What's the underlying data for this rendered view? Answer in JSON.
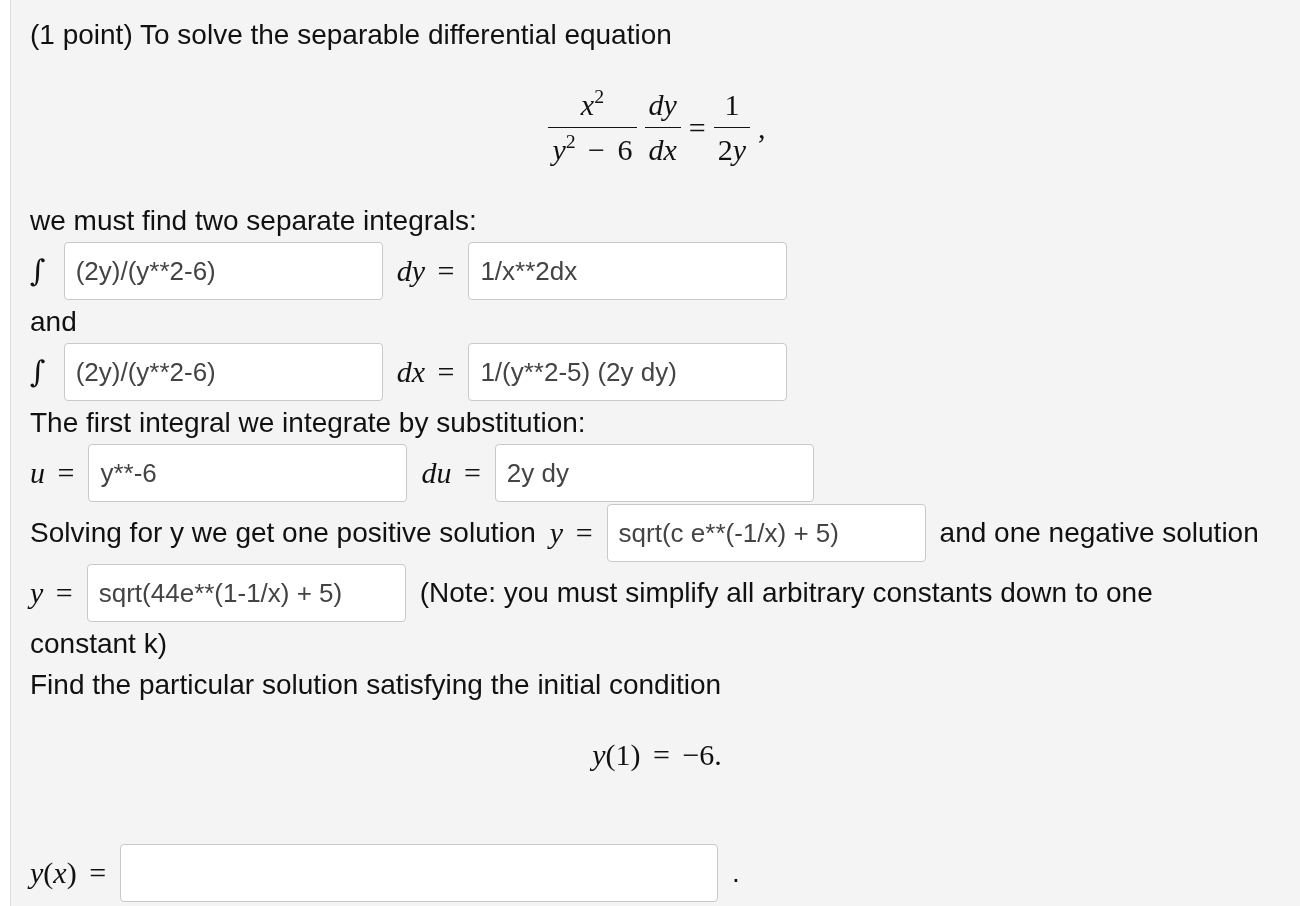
{
  "problem": {
    "blocks": [
      {
        "kind": "line",
        "items": [
          {
            "kind": "text",
            "text": "(1 point) To solve the separable differential equation"
          }
        ]
      },
      {
        "kind": "display",
        "parts": [
          {
            "kind": "fraction",
            "numerator": "x$^{2}$",
            "denominator": "y$^{2}$ − 6"
          },
          {
            "kind": "fraction",
            "numerator": "dy",
            "denominator": "dx"
          },
          {
            "kind": "symbol",
            "text": "="
          },
          {
            "kind": "fraction",
            "numerator": "1",
            "denominator": "2y"
          },
          {
            "kind": "symbol",
            "text": ","
          }
        ]
      },
      {
        "kind": "line",
        "items": [
          {
            "kind": "text",
            "text": "we must find two separate integrals:"
          }
        ]
      },
      {
        "kind": "line",
        "items": [
          {
            "kind": "integral",
            "text": "∫"
          },
          {
            "kind": "input",
            "value": "(2y)/(y**2-6)"
          },
          {
            "kind": "math",
            "text": "dy ="
          },
          {
            "kind": "input",
            "value": "1/x**2dx"
          }
        ]
      },
      {
        "kind": "line",
        "items": [
          {
            "kind": "text",
            "text": "and"
          }
        ]
      },
      {
        "kind": "line",
        "items": [
          {
            "kind": "integral",
            "text": "∫"
          },
          {
            "kind": "input",
            "value": "(2y)/(y**2-6)"
          },
          {
            "kind": "math",
            "text": "dx ="
          },
          {
            "kind": "input",
            "value": "1/(y**2-5) (2y dy)"
          }
        ]
      },
      {
        "kind": "line",
        "items": [
          {
            "kind": "text",
            "text": "The first integral we integrate by substitution:"
          }
        ]
      },
      {
        "kind": "line",
        "items": [
          {
            "kind": "math",
            "text": "u ="
          },
          {
            "kind": "input",
            "value": "y**-6"
          },
          {
            "kind": "math",
            "text": "du ="
          },
          {
            "kind": "input",
            "value": "2y dy"
          }
        ]
      },
      {
        "kind": "line",
        "items": [
          {
            "kind": "text",
            "text": "Solving for y we get one positive solution"
          },
          {
            "kind": "math",
            "text": "y ="
          },
          {
            "kind": "input",
            "value": "sqrt(c e**(-1/x) + 5)"
          },
          {
            "kind": "text",
            "text": "and one negative solution"
          }
        ]
      },
      {
        "kind": "line",
        "items": [
          {
            "kind": "math",
            "text": "y ="
          },
          {
            "kind": "input",
            "value": "sqrt(44e**(1-1/x) + 5)"
          },
          {
            "kind": "text",
            "text": "(Note: you must simplify all arbitrary constants down to one"
          }
        ]
      },
      {
        "kind": "line",
        "items": [
          {
            "kind": "text",
            "text": "constant k)"
          }
        ]
      },
      {
        "kind": "line",
        "items": [
          {
            "kind": "text",
            "text": "Find the particular solution satisfying the initial condition"
          }
        ]
      },
      {
        "kind": "display",
        "parts": [
          {
            "kind": "symbol",
            "text": "y(1) = −6."
          }
        ]
      },
      {
        "kind": "answer",
        "items": [
          {
            "kind": "math",
            "text": "y(x) ="
          },
          {
            "kind": "input"
          },
          {
            "kind": "text",
            "text": "."
          }
        ]
      }
    ]
  }
}
